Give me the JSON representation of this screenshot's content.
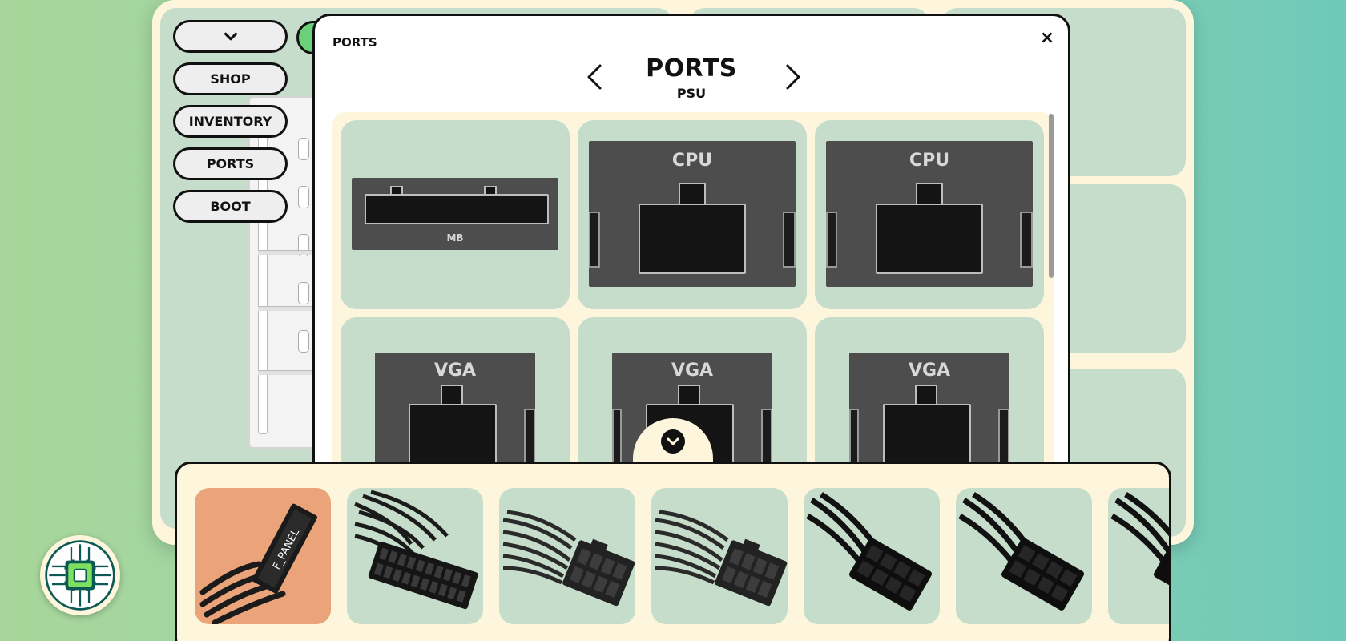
{
  "sidebar": {
    "items": [
      {
        "label": "",
        "icon": "chevron-down-icon"
      },
      {
        "label": "SHOP"
      },
      {
        "label": "INVENTORY"
      },
      {
        "label": "PORTS"
      },
      {
        "label": "BOOT"
      }
    ]
  },
  "modal": {
    "breadcrumb": "PORTS",
    "close_label": "×",
    "title": "PORTS",
    "subtitle": "PSU",
    "prev_icon": "chevron-left-icon",
    "next_icon": "chevron-right-icon",
    "ports": [
      {
        "type": "motherboard-24pin",
        "label": "MB"
      },
      {
        "type": "cpu-8pin",
        "label": "CPU"
      },
      {
        "type": "cpu-8pin",
        "label": "CPU"
      },
      {
        "type": "vga-8pin",
        "label": "VGA"
      },
      {
        "type": "vga-8pin",
        "label": "VGA"
      },
      {
        "type": "vga-8pin",
        "label": "VGA"
      }
    ]
  },
  "tray": {
    "collapse_icon": "chevron-down-icon",
    "cables": [
      {
        "name": "front-panel-cable",
        "label": "F_PANEL",
        "selected": true
      },
      {
        "name": "motherboard-24pin-cable",
        "selected": false
      },
      {
        "name": "pcie-8pin-cable",
        "selected": false
      },
      {
        "name": "pcie-8pin-cable",
        "selected": false
      },
      {
        "name": "cpu-8pin-cable",
        "selected": false
      },
      {
        "name": "cpu-8pin-cable",
        "selected": false
      },
      {
        "name": "cpu-8pin-cable",
        "selected": false
      }
    ]
  },
  "logo": {
    "icon": "circuit-chip-icon"
  },
  "colors": {
    "tile_green": "#c6ddcc",
    "cream": "#fdf6dd",
    "selected_tile": "#eba47a",
    "accent_green": "#6bd07a",
    "border": "#111111"
  }
}
